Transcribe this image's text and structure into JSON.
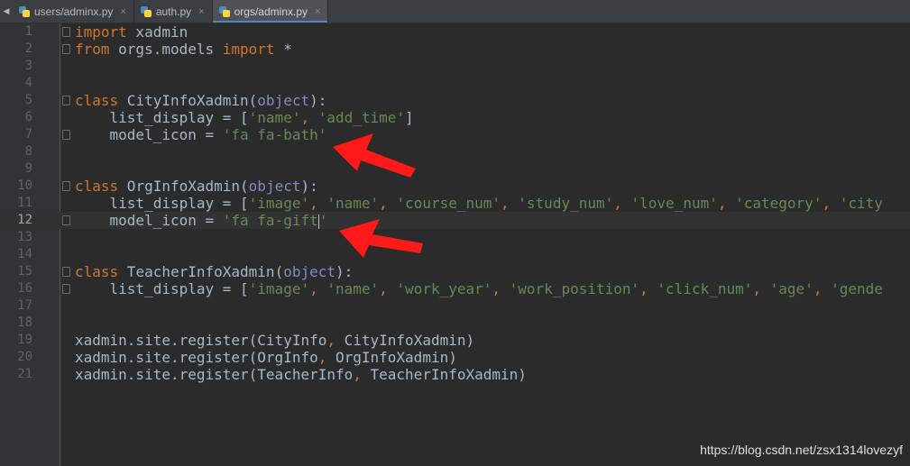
{
  "tabs": [
    {
      "label": "users/adminx.py",
      "icon": "python-file-icon",
      "active": false
    },
    {
      "label": "auth.py",
      "icon": "python-file-icon",
      "active": false
    },
    {
      "label": "orgs/adminx.py",
      "icon": "python-file-icon",
      "active": true
    }
  ],
  "close_glyph": "×",
  "current_line": 12,
  "lines": [
    {
      "n": "1",
      "t": [
        [
          "kw",
          "import"
        ],
        [
          "p",
          " xadmin"
        ]
      ]
    },
    {
      "n": "2",
      "t": [
        [
          "kw",
          "from"
        ],
        [
          "p",
          " orgs.models "
        ],
        [
          "kw",
          "import"
        ],
        [
          "p",
          " *"
        ]
      ]
    },
    {
      "n": "3",
      "t": []
    },
    {
      "n": "4",
      "t": []
    },
    {
      "n": "5",
      "t": [
        [
          "kw",
          "class"
        ],
        [
          "p",
          " CityInfoXadmin("
        ],
        [
          "builtin",
          "object"
        ],
        [
          "p",
          "):"
        ]
      ]
    },
    {
      "n": "6",
      "t": [
        [
          "p",
          "    list_display = ["
        ],
        [
          "str",
          "'name'"
        ],
        [
          "kw",
          ", "
        ],
        [
          "str",
          "'add_time'"
        ],
        [
          "p",
          "]"
        ]
      ]
    },
    {
      "n": "7",
      "t": [
        [
          "p",
          "    model_icon = "
        ],
        [
          "str",
          "'fa fa-bath'"
        ]
      ]
    },
    {
      "n": "8",
      "t": []
    },
    {
      "n": "9",
      "t": []
    },
    {
      "n": "10",
      "t": [
        [
          "kw",
          "class"
        ],
        [
          "p",
          " OrgInfoXadmin("
        ],
        [
          "builtin",
          "object"
        ],
        [
          "p",
          "):"
        ]
      ]
    },
    {
      "n": "11",
      "t": [
        [
          "p",
          "    list_display = ["
        ],
        [
          "str",
          "'image'"
        ],
        [
          "kw",
          ", "
        ],
        [
          "str",
          "'name'"
        ],
        [
          "kw",
          ", "
        ],
        [
          "str",
          "'course_num'"
        ],
        [
          "kw",
          ", "
        ],
        [
          "str",
          "'study_num'"
        ],
        [
          "kw",
          ", "
        ],
        [
          "str",
          "'love_num'"
        ],
        [
          "kw",
          ", "
        ],
        [
          "str",
          "'category'"
        ],
        [
          "kw",
          ", "
        ],
        [
          "str",
          "'city"
        ]
      ]
    },
    {
      "n": "12",
      "t": [
        [
          "p",
          "    model_icon = "
        ],
        [
          "str",
          "'fa fa-gift"
        ],
        [
          "caret",
          ""
        ],
        [
          "str",
          "'"
        ]
      ]
    },
    {
      "n": "13",
      "t": []
    },
    {
      "n": "14",
      "t": []
    },
    {
      "n": "15",
      "t": [
        [
          "kw",
          "class"
        ],
        [
          "p",
          " TeacherInfoXadmin("
        ],
        [
          "builtin",
          "object"
        ],
        [
          "p",
          "):"
        ]
      ]
    },
    {
      "n": "16",
      "t": [
        [
          "p",
          "    list_display = ["
        ],
        [
          "str",
          "'image'"
        ],
        [
          "kw",
          ", "
        ],
        [
          "str",
          "'name'"
        ],
        [
          "kw",
          ", "
        ],
        [
          "str",
          "'work_year'"
        ],
        [
          "kw",
          ", "
        ],
        [
          "str",
          "'work_position'"
        ],
        [
          "kw",
          ", "
        ],
        [
          "str",
          "'click_num'"
        ],
        [
          "kw",
          ", "
        ],
        [
          "str",
          "'age'"
        ],
        [
          "kw",
          ", "
        ],
        [
          "str",
          "'gende"
        ]
      ]
    },
    {
      "n": "17",
      "t": []
    },
    {
      "n": "18",
      "t": []
    },
    {
      "n": "19",
      "t": [
        [
          "p",
          "xadmin.site.register(CityInfo"
        ],
        [
          "kw",
          ", "
        ],
        [
          "p",
          "CityInfoXadmin)"
        ]
      ]
    },
    {
      "n": "20",
      "t": [
        [
          "p",
          "xadmin.site.register(OrgInfo"
        ],
        [
          "kw",
          ", "
        ],
        [
          "p",
          "OrgInfoXadmin)"
        ]
      ]
    },
    {
      "n": "21",
      "t": [
        [
          "p",
          "xadmin.site.register(TeacherInfo"
        ],
        [
          "kw",
          ", "
        ],
        [
          "p",
          "TeacherInfoXadmin)"
        ]
      ]
    }
  ],
  "fold_lines": [
    1,
    2,
    5,
    7,
    10,
    12,
    15,
    16
  ],
  "watermark": "https://blog.csdn.net/zsx1314lovezyf",
  "colors": {
    "keyword": "#cc7832",
    "string": "#6a8759",
    "builtin": "#8888c6",
    "text": "#a9b7c6",
    "arrow": "#ff1a1a"
  }
}
